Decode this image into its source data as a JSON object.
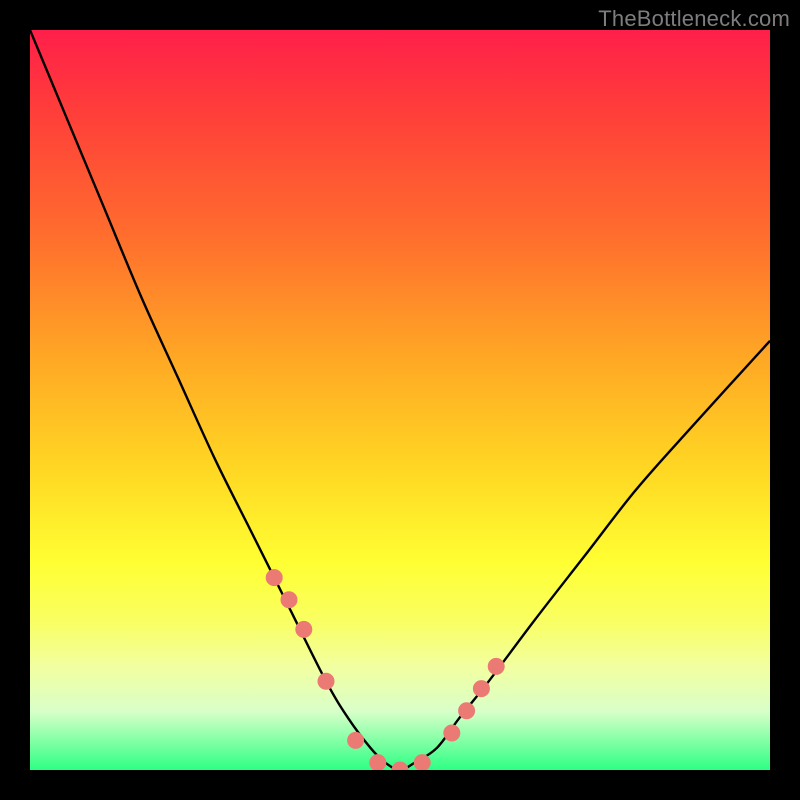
{
  "watermark": "TheBottleneck.com",
  "colors": {
    "curve_stroke": "#000000",
    "marker_fill": "#ec7a74",
    "marker_stroke": "#ec7a74",
    "background_border": "#000000"
  },
  "chart_data": {
    "type": "line",
    "title": "",
    "xlabel": "",
    "ylabel": "",
    "xlim": [
      0,
      100
    ],
    "ylim": [
      0,
      100
    ],
    "legend": false,
    "grid": false,
    "annotations": [
      "TheBottleneck.com"
    ],
    "series": [
      {
        "name": "bottleneck-curve",
        "x": [
          0,
          5,
          10,
          15,
          20,
          25,
          30,
          35,
          40,
          43,
          46,
          48,
          50,
          52,
          55,
          58,
          62,
          68,
          75,
          82,
          90,
          100
        ],
        "y": [
          100,
          88,
          76,
          64,
          53,
          42,
          32,
          22,
          12,
          7,
          3,
          1,
          0,
          1,
          3,
          7,
          12,
          20,
          29,
          38,
          47,
          58
        ]
      }
    ],
    "markers": {
      "name": "highlighted-points",
      "x": [
        33,
        35,
        37,
        40,
        44,
        47,
        50,
        53,
        57,
        59,
        61,
        63
      ],
      "y": [
        26,
        23,
        19,
        12,
        4,
        1,
        0,
        1,
        5,
        8,
        11,
        14
      ]
    },
    "background_gradient": {
      "direction": "top-to-bottom",
      "stops": [
        {
          "pos": 0.0,
          "color": "#ff1f4a"
        },
        {
          "pos": 0.5,
          "color": "#ffaa24"
        },
        {
          "pos": 0.78,
          "color": "#ffff33"
        },
        {
          "pos": 1.0,
          "color": "#2dff84"
        }
      ]
    }
  }
}
